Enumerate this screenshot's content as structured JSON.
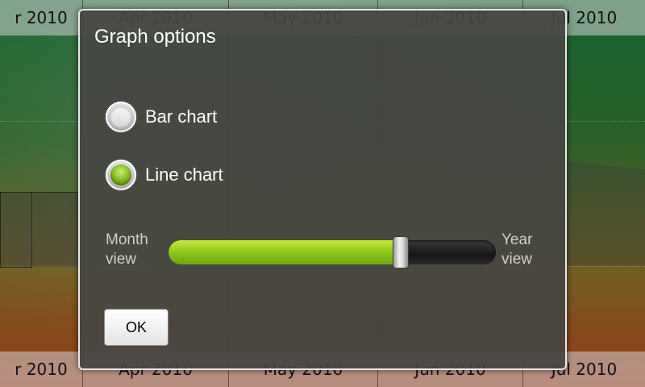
{
  "background": {
    "top_months": [
      "r 2010",
      "Apr 2010",
      "May 2010",
      "Jun 2010",
      "Jul 2010"
    ],
    "bottom_months": [
      "r 2010",
      "Apr 2010",
      "May 2010",
      "Jun 2010",
      "Jul 2010"
    ]
  },
  "dialog": {
    "title": "Graph options",
    "options": [
      {
        "label": "Bar chart",
        "checked": false
      },
      {
        "label": "Line chart",
        "checked": true
      }
    ],
    "slider": {
      "left_label_line1": "Month",
      "left_label_line2": "view",
      "right_label_line1": "Year",
      "right_label_line2": "view",
      "value_fraction": 0.71
    },
    "ok_label": "OK"
  }
}
